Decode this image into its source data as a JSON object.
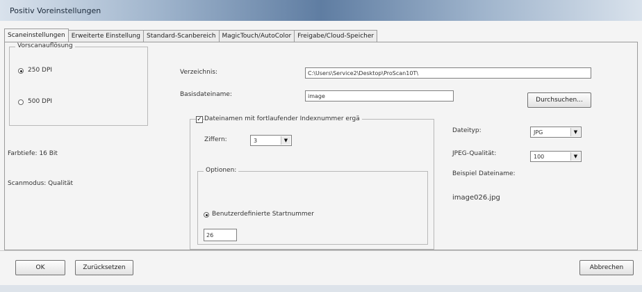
{
  "window": {
    "title": "Positiv Voreinstellungen"
  },
  "tabs": [
    {
      "label": "Scaneinstellungen",
      "active": true
    },
    {
      "label": "Erweiterte Einstellung"
    },
    {
      "label": "Standard-Scanbereich"
    },
    {
      "label": "MagicTouch/AutoColor"
    },
    {
      "label": "Freigabe/Cloud-Speicher"
    }
  ],
  "prescan": {
    "legend": "Vorscanauflösung",
    "option_250": "250 DPI",
    "option_500": "500 DPI",
    "selected": "250 DPI"
  },
  "info": {
    "color_depth": "Farbtiefe: 16 Bit",
    "scan_mode": "Scanmodus: Qualität"
  },
  "directory": {
    "label": "Verzeichnis:",
    "value": "C:\\Users\\Service2\\Desktop\\ProScan10T\\"
  },
  "basename": {
    "label": "Basisdateiname:",
    "value": "image"
  },
  "browse_button": "Durchsuchen...",
  "index": {
    "checkbox_label": "Dateinamen mit fortlaufender Indexnummer ergä",
    "checked": true,
    "digits_label": "Ziffern:",
    "digits_value": "3",
    "options_legend": "Optionen:",
    "custom_start_label": "Benutzerdefinierte Startnummer",
    "start_value": "26"
  },
  "filetype": {
    "label": "Dateityp:",
    "value": "JPG"
  },
  "jpeg_quality": {
    "label": "JPEG-Qualität:",
    "value": "100"
  },
  "example": {
    "label": "Beispiel Dateiname:",
    "value": "image026.jpg"
  },
  "footer": {
    "ok": "OK",
    "reset": "Zurücksetzen",
    "cancel": "Abbrechen"
  }
}
